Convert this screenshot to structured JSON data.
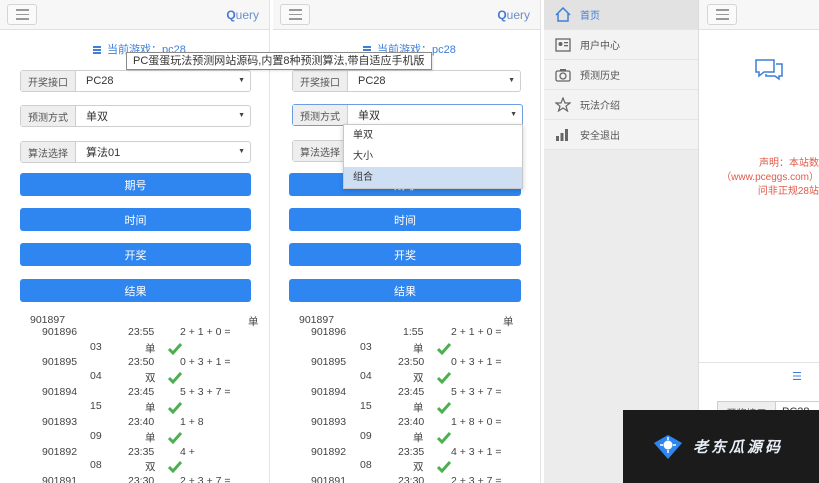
{
  "tooltip": {
    "text": "PC蛋蛋玩法预测网站源码,内置8种预测算法,带自适应手机版"
  },
  "panel1": {
    "query_label": "Query",
    "current_game": "当前游戏：pc28",
    "fields": [
      {
        "label": "开奖接口",
        "value": "PC28"
      },
      {
        "label": "预测方式",
        "value": "单双"
      },
      {
        "label": "算法选择",
        "value": "算法01"
      }
    ],
    "buttons": [
      "期号",
      "时间",
      "开奖",
      "结果"
    ],
    "results": {
      "first_period": "901897",
      "first_result": "单",
      "rows": [
        {
          "period": "901896",
          "time": "23:55",
          "draw": "2 + 1 + 0 =",
          "sum": "03",
          "result": "单"
        },
        {
          "period": "901895",
          "time": "23:50",
          "draw": "0 + 3 + 1 =",
          "sum": "04",
          "result": "双"
        },
        {
          "period": "901894",
          "time": "23:45",
          "draw": "5 + 3 + 7 =",
          "sum": "15",
          "result": "单"
        },
        {
          "period": "901893",
          "time": "23:40",
          "draw": "1 + 8",
          "sum": "09",
          "result": "单"
        },
        {
          "period": "901892",
          "time": "23:35",
          "draw": "4 +",
          "sum": "08",
          "result": "双"
        }
      ],
      "partial_period": "901891",
      "partial_time": "23:30",
      "partial_draw": "2 + 3 + 7 ="
    }
  },
  "panel2": {
    "query_label": "Query",
    "current_game": "当前游戏：pc28",
    "fields": [
      {
        "label": "开奖接口",
        "value": "PC28"
      },
      {
        "label": "预测方式",
        "value": "单双"
      },
      {
        "label": "算法选择",
        "value": ""
      }
    ],
    "dropdown_options": [
      "单双",
      "大小",
      "组合"
    ],
    "buttons": [
      "期号",
      "时间",
      "开奖",
      "结果"
    ],
    "results": {
      "first_period": "901897",
      "first_result": "单",
      "rows": [
        {
          "period": "901896",
          "time": "1:55",
          "draw": "2 + 1 + 0 =",
          "sum": "03",
          "result": "单"
        },
        {
          "period": "901895",
          "time": "23:50",
          "draw": "0 + 3 + 1 =",
          "sum": "04",
          "result": "双"
        },
        {
          "period": "901894",
          "time": "23:45",
          "draw": "5 + 3 + 7 =",
          "sum": "15",
          "result": "单"
        },
        {
          "period": "901893",
          "time": "23:40",
          "draw": "1 + 8 + 0 =",
          "sum": "09",
          "result": "单"
        },
        {
          "period": "901892",
          "time": "23:35",
          "draw": "4 + 3 + 1 =",
          "sum": "08",
          "result": "双"
        }
      ],
      "partial_period": "901891",
      "partial_time": "23:30",
      "partial_draw": "2 + 3 + 7 ="
    }
  },
  "panel3": {
    "nav": [
      {
        "label": "首页",
        "icon": "home-icon",
        "active": true
      },
      {
        "label": "用户中心",
        "icon": "user-card-icon",
        "active": false
      },
      {
        "label": "预测历史",
        "icon": "camera-icon",
        "active": false
      },
      {
        "label": "玩法介绍",
        "icon": "star-icon",
        "active": false
      },
      {
        "label": "安全退出",
        "icon": "bar-chart-icon",
        "active": false
      }
    ]
  },
  "panel4": {
    "notice_lines": [
      "声明：本站数",
      "（www.pceggs.com）",
      "问非正规28站"
    ],
    "field_label": "开奖接口",
    "field_value": "PC28",
    "section_mark": "☰"
  },
  "watermark": {
    "text": "老东瓜源码"
  },
  "colors": {
    "primary_button": "#2f86f0",
    "link_blue": "#3f7fd9",
    "check_green": "#4caf50",
    "notice_red": "#e05a4a",
    "watermark_bg": "#1b1b1b"
  }
}
